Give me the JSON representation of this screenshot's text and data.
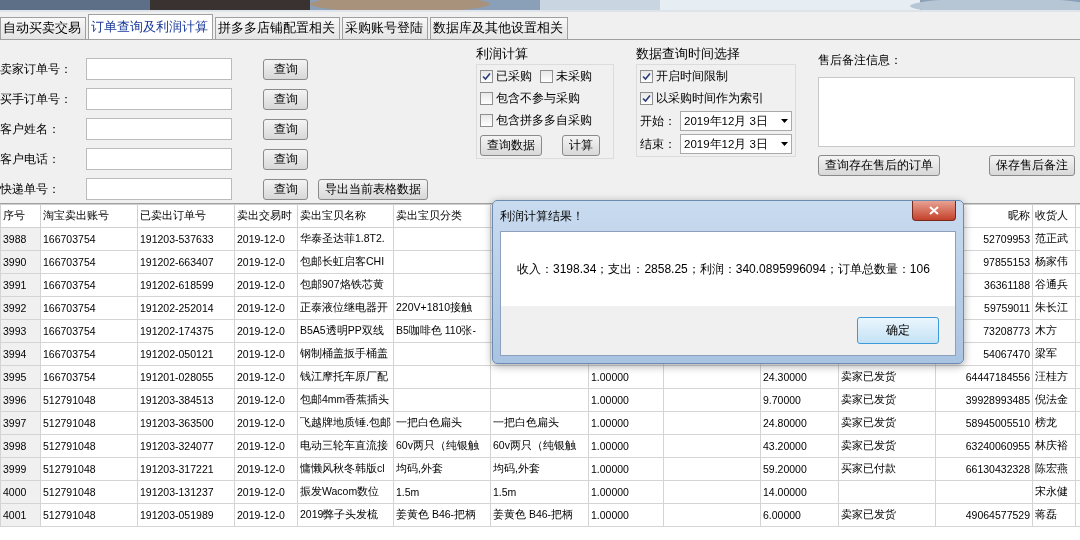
{
  "tabs": [
    {
      "label": "自动买卖交易",
      "selected": false
    },
    {
      "label": "订单查询及利润计算",
      "selected": true
    },
    {
      "label": "拼多多店铺配置相关",
      "selected": false
    },
    {
      "label": "采购账号登陆",
      "selected": false
    },
    {
      "label": "数据库及其他设置相关",
      "selected": false
    }
  ],
  "search_fields": [
    {
      "label": "卖家订单号：",
      "button": "查询"
    },
    {
      "label": "买手订单号：",
      "button": "查询"
    },
    {
      "label": "客户姓名：",
      "button": "查询"
    },
    {
      "label": "客户电话：",
      "button": "查询"
    },
    {
      "label": "快递单号：",
      "button": "查询"
    }
  ],
  "export_button": "导出当前表格数据",
  "profit_group": {
    "title": "利润计算",
    "option_rows": [
      [
        {
          "label": "已采购",
          "checked": true
        },
        {
          "label": "未采购",
          "checked": false
        }
      ],
      [
        {
          "label": "包含不参与采购",
          "checked": false
        }
      ],
      [
        {
          "label": "包含拼多多自采购",
          "checked": false
        }
      ]
    ],
    "buttons": [
      "查询数据",
      "计算"
    ]
  },
  "time_group": {
    "title": "数据查询时间选择",
    "options": [
      {
        "label": "开启时间限制",
        "checked": true
      },
      {
        "label": "以采购时间作为索引",
        "checked": true
      }
    ],
    "dates": [
      {
        "label": "开始：",
        "value": "2019年12月 3日"
      },
      {
        "label": "结束：",
        "value": "2019年12月 3日"
      }
    ]
  },
  "after_sales": {
    "label": "售后备注信息：",
    "buttons": [
      "查询存在售后的订单",
      "保存售后备注"
    ]
  },
  "table": {
    "columns": [
      "序号",
      "淘宝卖出账号",
      "已卖出订单号",
      "卖出交易时",
      "卖出宝贝名称",
      "卖出宝贝分类",
      null,
      null,
      null,
      null,
      null,
      "昵称",
      "收货人"
    ],
    "rows": [
      {
        "cells": [
          "3988",
          "166703754",
          "191203-537633",
          "2019-12-0",
          "华泰圣达菲1.8T2.",
          null,
          null,
          null,
          null,
          null,
          null,
          "52709953",
          "范正武"
        ]
      },
      {
        "cells": [
          "3990",
          "166703754",
          "191202-663407",
          "2019-12-0",
          "包邮长虹启客CHI",
          null,
          null,
          null,
          null,
          null,
          null,
          "97855153",
          "杨家伟"
        ]
      },
      {
        "cells": [
          "3991",
          "166703754",
          "191202-618599",
          "2019-12-0",
          "包邮907烙铁芯黄",
          null,
          null,
          null,
          null,
          null,
          null,
          "36361188",
          "谷通兵"
        ]
      },
      {
        "cells": [
          "3992",
          "166703754",
          "191202-252014",
          "2019-12-0",
          "正泰液位继电器开",
          "220V+1810接触",
          null,
          null,
          null,
          null,
          null,
          "59759011",
          "朱长江"
        ]
      },
      {
        "cells": [
          "3993",
          "166703754",
          "191202-174375",
          "2019-12-0",
          "B5A5透明PP双线",
          "B5咖啡色 110张-",
          null,
          null,
          null,
          null,
          null,
          "73208773",
          "木方"
        ]
      },
      {
        "cells": [
          "3994",
          "166703754",
          "191202-050121",
          "2019-12-0",
          "钢制桶盖扳手桶盖",
          null,
          null,
          null,
          null,
          null,
          null,
          "54067470",
          "梁军"
        ]
      },
      {
        "cells": [
          "3995",
          "166703754",
          "191201-028055",
          "2019-12-0",
          "钱江摩托车原厂配",
          null,
          null,
          "1.00000",
          null,
          "24.30000",
          "卖家已发货",
          "64447184556",
          "汪桂方"
        ]
      },
      {
        "cells": [
          "3996",
          "512791048",
          "191203-384513",
          "2019-12-0",
          "包邮4mm香蕉插头",
          null,
          null,
          "1.00000",
          null,
          "9.70000",
          "卖家已发货",
          "39928993485",
          "倪法金"
        ]
      },
      {
        "cells": [
          "3997",
          "512791048",
          "191203-363500",
          "2019-12-0",
          "飞越牌地质锤.包邮",
          "一把白色扁头",
          "一把白色扁头",
          "1.00000",
          null,
          "24.80000",
          "卖家已发货",
          "58945005510",
          "榜龙"
        ]
      },
      {
        "cells": [
          "3998",
          "512791048",
          "191203-324077",
          "2019-12-0",
          "电动三轮车直流接",
          "60v两只（纯银触",
          "60v两只（纯银触",
          "1.00000",
          null,
          "43.20000",
          "卖家已发货",
          "63240060955",
          "林庆裕"
        ]
      },
      {
        "cells": [
          "3999",
          "512791048",
          "191203-317221",
          "2019-12-0",
          "慵懒风秋冬韩版cl",
          "均码,外套",
          "均码,外套",
          "1.00000",
          null,
          "59.20000",
          "买家已付款",
          "66130432328",
          "陈宏燕"
        ]
      },
      {
        "cells": [
          "4000",
          "512791048",
          "191203-131237",
          "2019-12-0",
          "振发Wacom数位",
          "1.5m",
          "1.5m",
          "1.00000",
          null,
          "14.00000",
          null,
          null,
          "宋永健"
        ]
      },
      {
        "cells": [
          "4001",
          "512791048",
          "191203-051989",
          "2019-12-0",
          "2019弊子头发梳",
          "姜黄色 B46-把柄",
          "姜黄色 B46-把柄",
          "1.00000",
          null,
          "6.00000",
          "卖家已发货",
          "49064577529",
          "蒋磊"
        ]
      }
    ]
  },
  "dialog": {
    "title": "利润计算结果！",
    "message": "收入：3198.34；支出：2858.25；利润：340.0895996094；订单总数量：106",
    "button": "确定"
  }
}
